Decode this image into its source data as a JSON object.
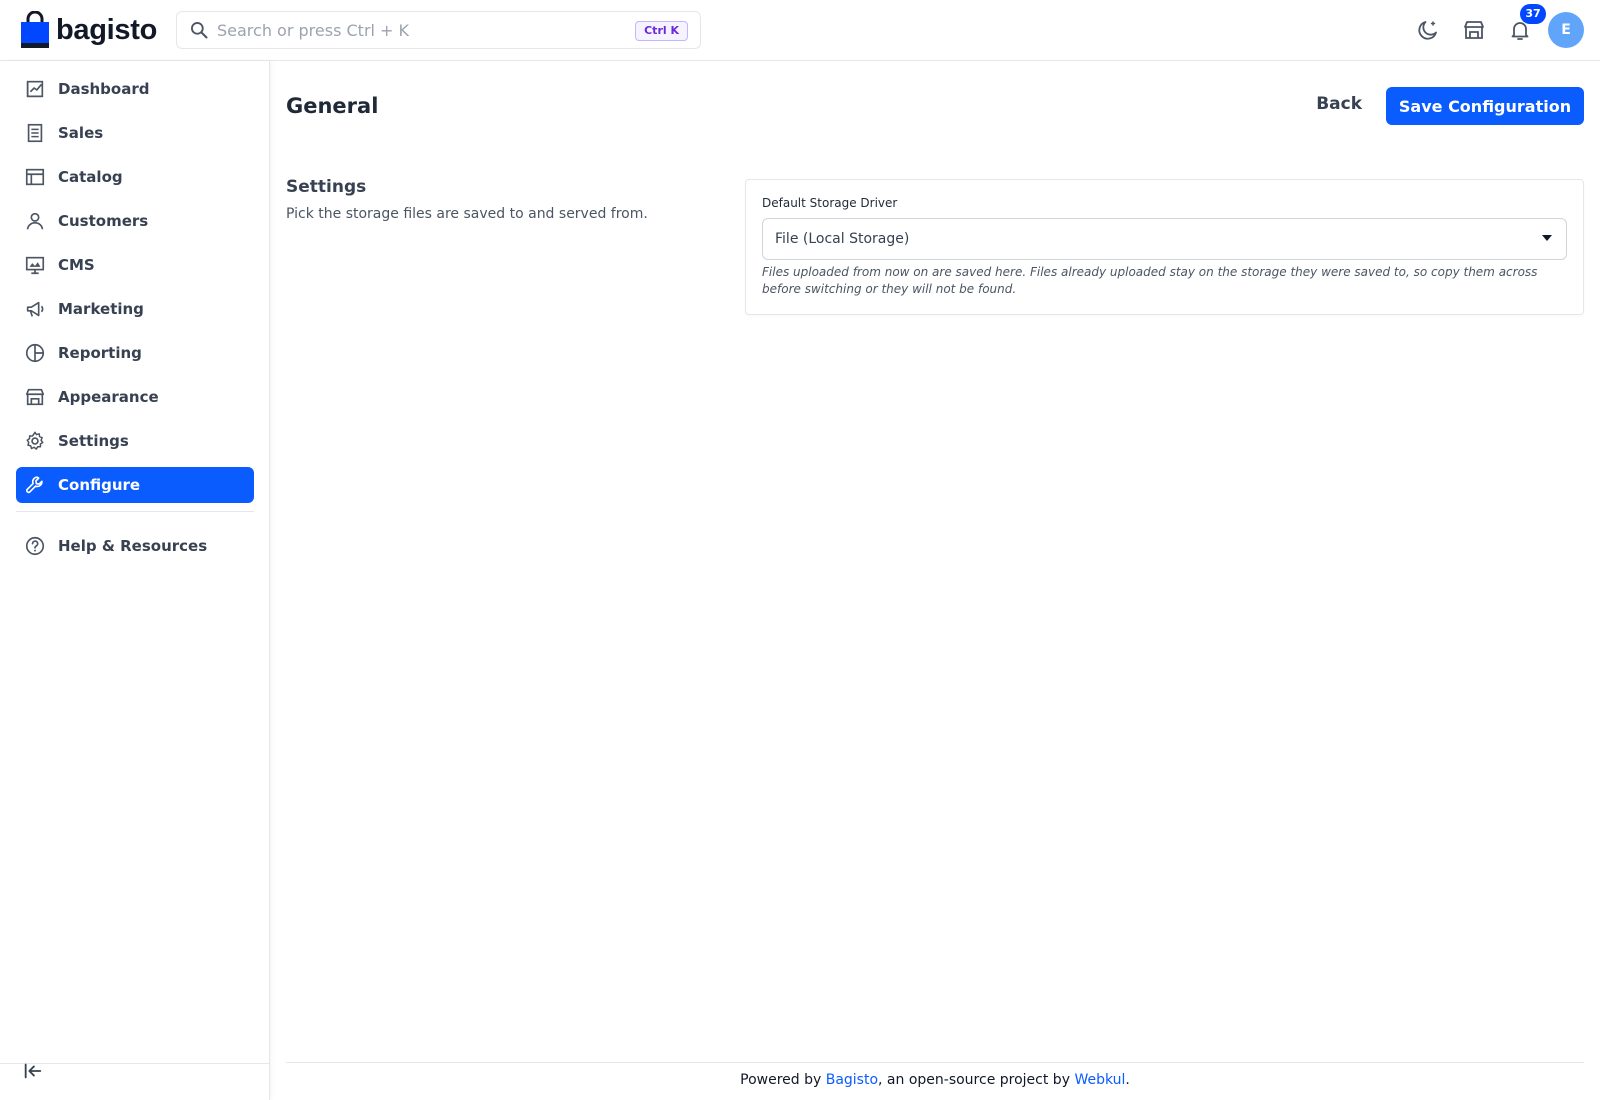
{
  "brand": {
    "name": "bagisto",
    "color": "#0047ff"
  },
  "search": {
    "placeholder": "Search or press Ctrl + K",
    "shortcut": "Ctrl K"
  },
  "header": {
    "notification_count": "37",
    "avatar_initial": "E"
  },
  "sidebar": {
    "items": [
      {
        "label": "Dashboard",
        "icon": "dashboard-icon"
      },
      {
        "label": "Sales",
        "icon": "receipt-icon"
      },
      {
        "label": "Catalog",
        "icon": "catalog-icon"
      },
      {
        "label": "Customers",
        "icon": "user-icon"
      },
      {
        "label": "CMS",
        "icon": "monitor-icon"
      },
      {
        "label": "Marketing",
        "icon": "megaphone-icon"
      },
      {
        "label": "Reporting",
        "icon": "pie-chart-icon"
      },
      {
        "label": "Appearance",
        "icon": "store-icon"
      },
      {
        "label": "Settings",
        "icon": "gear-icon"
      },
      {
        "label": "Configure",
        "icon": "wrench-icon",
        "active": true
      }
    ],
    "help": {
      "label": "Help & Resources",
      "icon": "help-circle-icon"
    }
  },
  "main": {
    "title": "General",
    "back_label": "Back",
    "save_label": "Save Configuration",
    "section": {
      "title": "Settings",
      "description": "Pick the storage files are saved to and served from."
    },
    "field": {
      "label": "Default Storage Driver",
      "value": "File (Local Storage)",
      "help": "Files uploaded from now on are saved here. Files already uploaded stay on the storage they were saved to, so copy them across before switching or they will not be found."
    }
  },
  "footer": {
    "prefix": "Powered by ",
    "link1": "Bagisto",
    "middle": ", an open-source project by ",
    "link2": "Webkul",
    "suffix": "."
  }
}
